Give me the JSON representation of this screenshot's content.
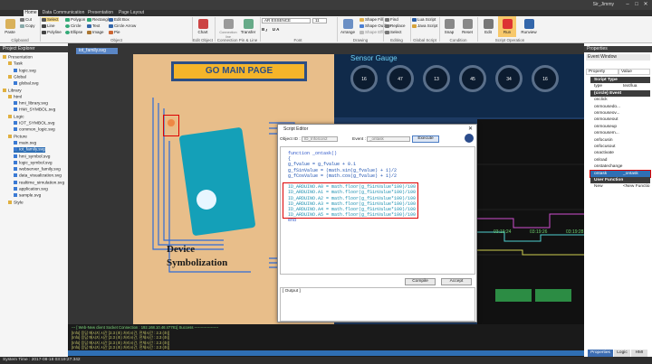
{
  "app": {
    "title": "",
    "user": "Sir_Jimmy"
  },
  "menu": {
    "tabs": [
      "Home",
      "Data Communication",
      "Presentation",
      "Page Layout"
    ]
  },
  "ribbon": {
    "clipboard": {
      "cut": "Cut",
      "copy": "Copy",
      "paste": "Paste",
      "group": "Clipboard"
    },
    "object": {
      "select": "Select",
      "line": "Line",
      "polyline": "Polyline",
      "polygon": "Polygon",
      "circle": "Circle",
      "ellipse": "Ellipse",
      "rectangle": "Rectangle",
      "text": "Text",
      "image": "Image",
      "editbox": "Edit Box",
      "circle_arrow": "Circle Arrow",
      "pie": "Pie",
      "group": "Object"
    },
    "edit_object": {
      "chart": "Chart",
      "group": "Edit Object"
    },
    "connection": {
      "connection_line": "Connection line",
      "transfer": "Transfer",
      "group": "Connection Pin & Line"
    },
    "font": {
      "name": "AR ESSENCE",
      "size": "11",
      "group": "Font"
    },
    "drawing": {
      "arrange": "Arrange",
      "shape_fill": "Shape Fill",
      "shape_outline": "Shape Outline",
      "shape_effects": "Shape Effects",
      "group": "Drawing"
    },
    "editing": {
      "find": "Find",
      "replace": "Replace",
      "select": "Select",
      "group": "Editing"
    },
    "global_script": {
      "java_script": "Java Script",
      "group": "Global Script"
    },
    "condition": {
      "snap": "Snap",
      "reset": "Reset",
      "group": "Condition"
    },
    "script_operation": {
      "edit": "Edit",
      "run": "Run",
      "runview": "Runview",
      "group": "Script Operation"
    }
  },
  "explorer": {
    "title": "Project Explorer",
    "items": [
      "Presentation",
      "Task",
      "logic.svg",
      "Global",
      "global.svg",
      "Library",
      "html",
      "hmi_library.svg",
      "HMI_SYMBOL.svg",
      "Logic",
      "IOT_SYMBOL.svg",
      "common_logic.svg",
      "Picture",
      "main.svg",
      "iot_family.svg",
      "hmi_symbol.svg",
      "logic_symbol.svg",
      "webserver_family.svg",
      "data_visualization.svg",
      "realtime_simulation.svg",
      "application.svg",
      "sample.svg",
      "Style"
    ]
  },
  "document": {
    "tab": "iot_family.svg",
    "go_main": "GO MAIN PAGE",
    "sensor_title": "Sensor Gauge",
    "gauge_values": [
      "16",
      "47",
      "13",
      "45",
      "34",
      "16"
    ],
    "device_text_1": "Device",
    "device_text_2": "Symbolization",
    "times": [
      "03:19:24",
      "03:19:26",
      "03:19:28"
    ]
  },
  "dialog": {
    "title": "Script Editor",
    "object_id_label": "Object ID :",
    "object_id": "ID_InfoIcon2",
    "event_label": "Event :",
    "event": "_ontask",
    "execute": "Execute",
    "code": [
      "function _ontask()",
      "{",
      "   g_fvalue = g_fvalue + 0.1",
      "   g_fSinValue = (math.sin(g_fvalue) + 1)/2",
      "   g_fCosValue = (math.cos(g_fvalue) + 1)/2",
      "",
      "   ID_ARDUINO.A0 = math.floor(g_fSinValue*100)/100",
      "   ID_ARDUINO.A1 = math.floor(g_fSinValue*100)/100",
      "   ID_ARDUINO.A2 = math.floor(g_fSinValue*100)/100",
      "   ID_ARDUINO.A3 = math.floor(g_fSinValue*100)/100",
      "   ID_ARDUINO.A4 = math.floor(g_fSinValue*100)/100",
      "   ID_ARDUINO.A5 = math.floor(g_fSinValue*100)/100",
      "end"
    ],
    "compile": "Compile",
    "accept": "Accept",
    "output_label": "[ Output ]"
  },
  "output": {
    "lines": [
      "--- [ Web-New client Socket Connection : 192.168.10.46:47781] Success -------------------",
      "[Info] 응답 메시지 시간 [2.3 (초) 처리시간, 전체시간 : 2.3 (초)]",
      "[Info] 응답 메시지 시간 [2.3 (초) 처리시간, 전체시간 : 2.3 (초)]",
      "[Info] 응답 메시지 시간 [2.3 (초) 처리시간, 전체시간 : 2.3 (초)]",
      "[Info] 응답 메시지 시간 [2.3 (초) 처리시간, 전체시간 : 2.3 (초)]",
      "[Info] 응답 메시지 시간 [2.3 (초) 처리시간, 전체시간 : 2.3 (초)]"
    ]
  },
  "status": {
    "text": "System Time : 2017-08-18 03:19:27.342"
  },
  "properties": {
    "title": "Properties",
    "panel": "Event Window",
    "col_prop": "Property",
    "col_value": "Value",
    "rows": [
      [
        "Script Type",
        ""
      ],
      [
        "type",
        "text/lua"
      ],
      [
        "(circle) Event",
        ""
      ],
      [
        "onclick",
        ""
      ],
      [
        "onmousedo...",
        ""
      ],
      [
        "onmouseov...",
        ""
      ],
      [
        "onmouseout",
        ""
      ],
      [
        "onmouseup",
        ""
      ],
      [
        "onmousem...",
        ""
      ],
      [
        "onfocusin",
        ""
      ],
      [
        "onfocusout",
        ""
      ],
      [
        "onactivate",
        ""
      ],
      [
        "onload",
        ""
      ],
      [
        "onstatechange",
        ""
      ],
      [
        "ontask",
        "_ontask"
      ],
      [
        "User Function",
        ""
      ],
      [
        "New",
        "<New Functio..."
      ]
    ],
    "tabs": [
      "Properties",
      "Logic",
      "HMI"
    ]
  }
}
